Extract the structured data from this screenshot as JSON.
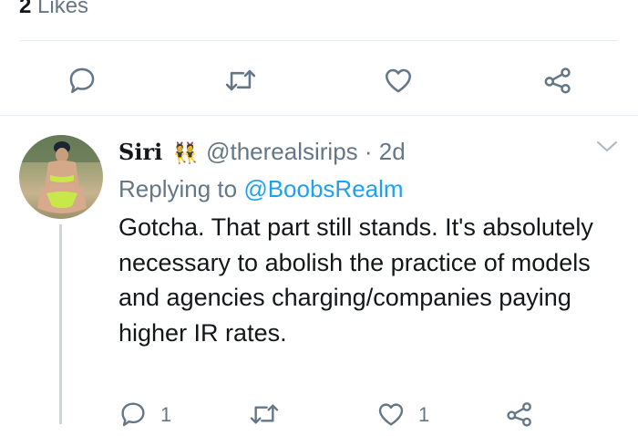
{
  "likes": {
    "count": "2",
    "label": "Likes"
  },
  "action_bar": {
    "icons": [
      "reply-icon",
      "retweet-icon",
      "like-icon",
      "share-icon"
    ],
    "color": "#657786"
  },
  "reply": {
    "name": "Siri",
    "emoji": "👯",
    "handle": "@therealsirips",
    "separator": "·",
    "time": "2d",
    "replying_prefix": "Replying to",
    "replying_to": "@BoobsRealm",
    "text": "Gotcha. That part still stands. It's absolutely necessary to abolish the practice of models and agencies charging/companies paying higher IR rates.",
    "actions": {
      "reply_count": "1",
      "retweet_count": "",
      "like_count": "1"
    }
  },
  "colors": {
    "accent": "#1da1f2",
    "secondary_text": "#657786",
    "divider": "#e6ecf0"
  }
}
